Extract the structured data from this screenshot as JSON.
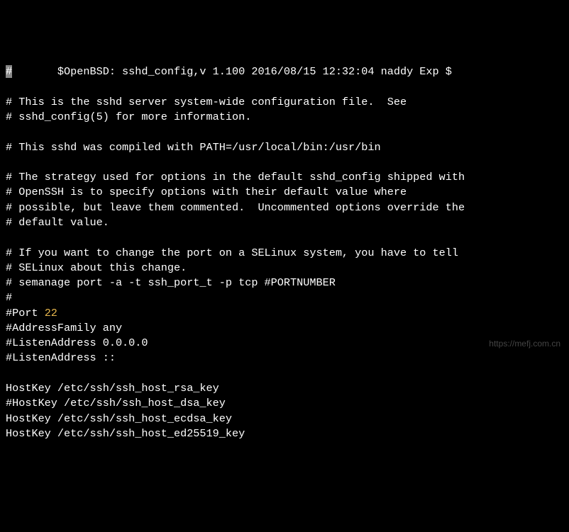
{
  "header": "#       $OpenBSD: sshd_config,v 1.100 2016/08/15 12:32:04 naddy Exp $",
  "lines": [
    "",
    "# This is the sshd server system-wide configuration file.  See",
    "# sshd_config(5) for more information.",
    "",
    "# This sshd was compiled with PATH=/usr/local/bin:/usr/bin",
    "",
    "# The strategy used for options in the default sshd_config shipped with",
    "# OpenSSH is to specify options with their default value where",
    "# possible, but leave them commented.  Uncommented options override the",
    "# default value.",
    "",
    "# If you want to change the port on a SELinux system, you have to tell",
    "# SELinux about this change.",
    "# semanage port -a -t ssh_port_t -p tcp #PORTNUMBER",
    "#"
  ],
  "port_prefix": "#Port ",
  "port_value": "22",
  "lines_after": [
    "#AddressFamily any",
    "#ListenAddress 0.0.0.0",
    "#ListenAddress ::",
    "",
    "HostKey /etc/ssh/ssh_host_rsa_key",
    "#HostKey /etc/ssh/ssh_host_dsa_key",
    "HostKey /etc/ssh/ssh_host_ecdsa_key",
    "HostKey /etc/ssh/ssh_host_ed25519_key"
  ],
  "watermark": "https://mefj.com.cn"
}
